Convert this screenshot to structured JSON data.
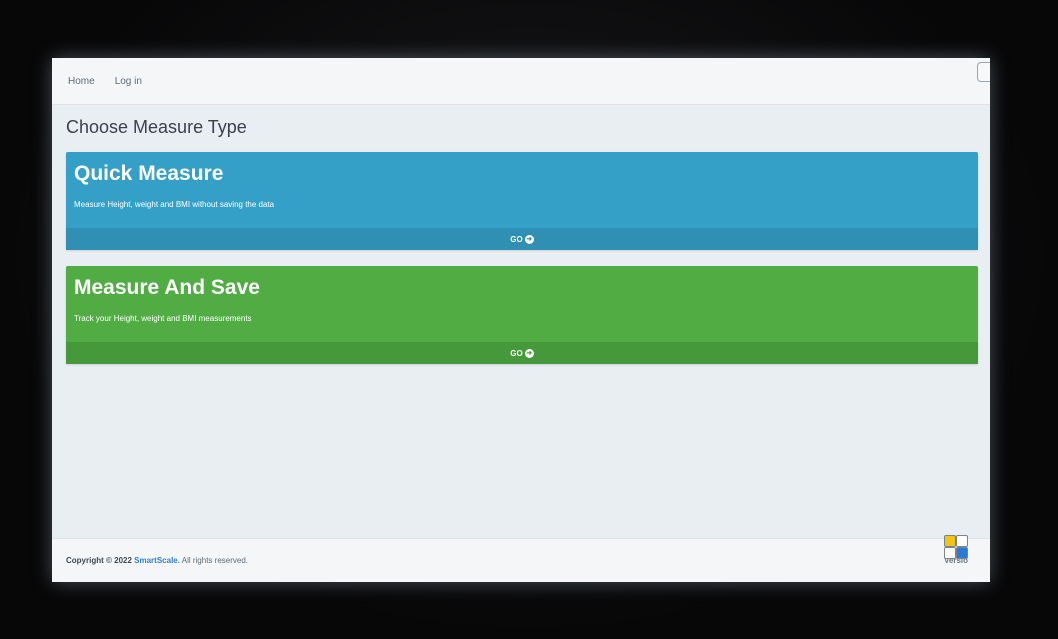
{
  "navbar": {
    "items": [
      {
        "label": "Home"
      },
      {
        "label": "Log in"
      }
    ]
  },
  "page": {
    "title": "Choose Measure Type"
  },
  "cards": [
    {
      "title": "Quick Measure",
      "description": "Measure Height, weight and BMI without saving the data",
      "action_label": "GO",
      "color": "#34a0c8"
    },
    {
      "title": "Measure And Save",
      "description": "Track your Height, weight and BMI measurements",
      "action_label": "GO",
      "color": "#50ac43"
    }
  ],
  "footer": {
    "copyright_prefix": "Copyright © 2022",
    "brand": "SmartScale.",
    "rights": "All rights reserved.",
    "version_label": "Versio"
  },
  "icons": {
    "go": "arrow-circle-right-icon"
  }
}
